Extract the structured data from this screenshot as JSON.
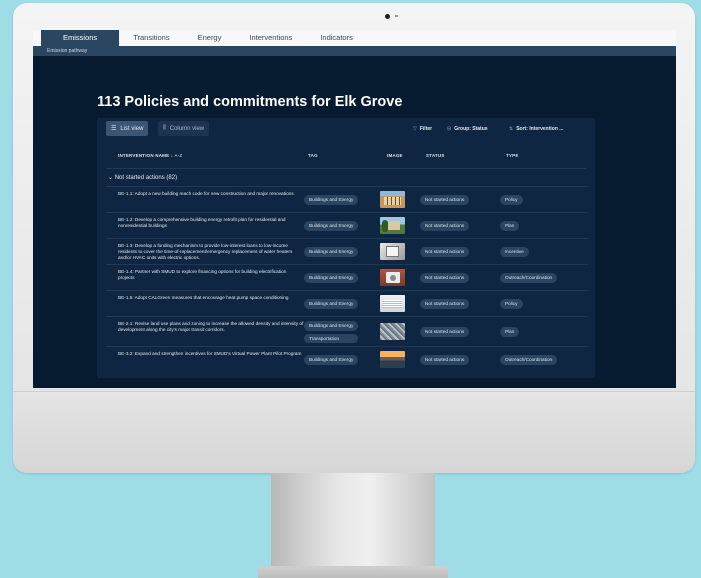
{
  "app": {
    "tabs": [
      {
        "label": "Emissions",
        "active": true
      },
      {
        "label": "Transitions",
        "active": false
      },
      {
        "label": "Energy",
        "active": false
      },
      {
        "label": "Interventions",
        "active": false
      },
      {
        "label": "Indicators",
        "active": false
      }
    ],
    "subtab": "Emission pathway"
  },
  "main": {
    "title": "113 Policies and commitments for Elk Grove",
    "toolbar": {
      "list_view": "List view",
      "column_view": "Column view",
      "filter": "Filter",
      "group": "Group: Status",
      "sort": "Sort: Intervention ..."
    },
    "columns": {
      "name": "INTERVENTION NAME",
      "name_sort": "A-Z",
      "tag": "TAG",
      "image": "IMAGE",
      "status": "STATUS",
      "type": "TYPE"
    },
    "group_label": "Not started actions (82)",
    "rows": [
      {
        "name": "BE-1.1: Adopt a new building reach code for new construction and major renovations.",
        "tags": [
          "Buildings and Energy"
        ],
        "status": "Not started actions",
        "type": "Policy",
        "image_icon": "building-photo-icon"
      },
      {
        "name": "BE-1.2: Develop a comprehensive building energy retrofit plan for residential and nonresidential buildings",
        "tags": [
          "Buildings and Energy"
        ],
        "status": "Not started actions",
        "type": "Plan",
        "image_icon": "house-photo-icon"
      },
      {
        "name": "BE-1.3: Develop a funding mechanism to provide low-interest loans to low-income residents to cover the time-of-replacement/emergency replacement of water heaters and/or HVAC units with electric options.",
        "tags": [
          "Buildings and Energy"
        ],
        "status": "Not started actions",
        "type": "Incentive",
        "image_icon": "water-heater-photo-icon"
      },
      {
        "name": "BE-1.4: Partner with SMUD to explore financing options for building electrification projects",
        "tags": [
          "Buildings and Energy"
        ],
        "status": "Not started actions",
        "type": "Outreach/Coordination",
        "image_icon": "hvac-photo-icon"
      },
      {
        "name": "BE-1.5: Adopt CALGreen measures that encourage heat pump space conditioning",
        "tags": [
          "Buildings and Energy"
        ],
        "status": "Not started actions",
        "type": "Policy",
        "image_icon": "heat-pump-photo-icon"
      },
      {
        "name": "BE-2.1: Revise land use plans and zoning to increase the allowed density and intensity of development along the city's major transit corridors.",
        "tags": [
          "Buildings and Energy",
          "Transportation"
        ],
        "status": "Not started actions",
        "type": "Plan",
        "image_icon": "city-aerial-photo-icon"
      },
      {
        "name": "BE-3.2: Expand and strengthen incentives for SMUD's Virtual Power Plant Pilot Program",
        "tags": [
          "Buildings and Energy"
        ],
        "status": "Not started actions",
        "type": "Outreach/Coordination",
        "image_icon": "sunset-photo-icon"
      }
    ]
  },
  "colors": {
    "screen_bg": "#061a30",
    "panel_bg": "#0e2642",
    "tab_active": "#2b4661",
    "pill_bg": "#2a4462"
  }
}
